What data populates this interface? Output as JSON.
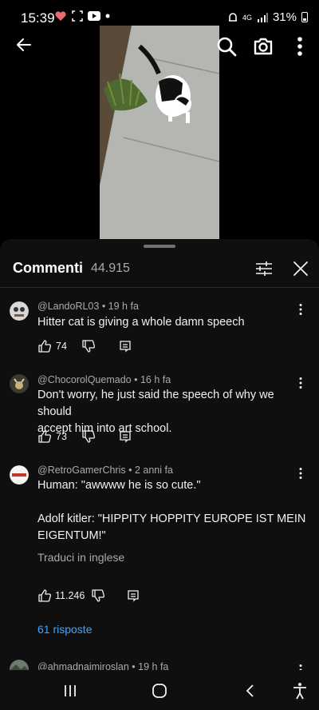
{
  "status_bar": {
    "time": "15:39",
    "network": "4G",
    "battery": "31%"
  },
  "panel": {
    "title": "Commenti",
    "count": "44.915"
  },
  "comments": [
    {
      "author": "@LandoRL03",
      "time": "19 h fa",
      "lines": [
        "Hitter cat is giving a whole damn speech"
      ],
      "likes": "74"
    },
    {
      "author": "@ChocorolQuemado",
      "time": "16 h fa",
      "lines": [
        "Don't worry, he just said the speech of why we should",
        "accept him into art school."
      ],
      "likes": "73"
    },
    {
      "author": "@RetroGamerChris",
      "time": "2 anni fa",
      "lines": [
        "Human: \"awwww he is so cute.\"",
        "",
        "Adolf kitler: \"HIPPITY HOPPITY EUROPE IST MEIN",
        "EIGENTUM!\""
      ],
      "likes": "11.246",
      "translate": "Traduci in inglese",
      "replies": "61 risposte"
    },
    {
      "author": "@ahmadnajmiroslan",
      "time": "19 h fa"
    }
  ],
  "separator": " • "
}
